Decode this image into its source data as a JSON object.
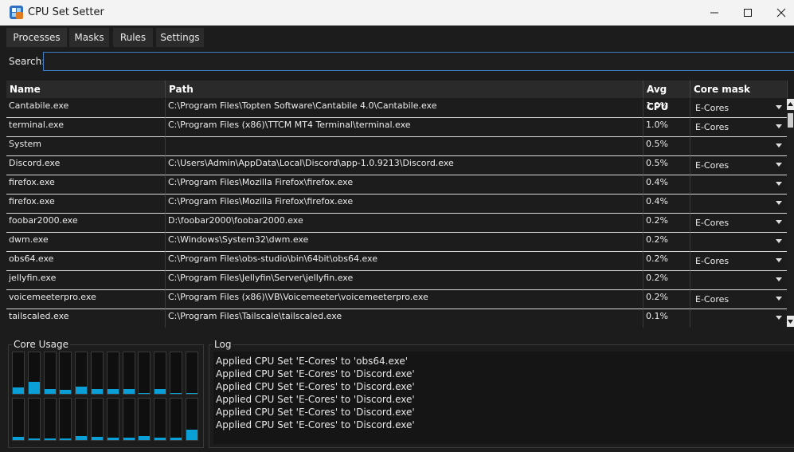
{
  "window": {
    "title": "CPU Set Setter",
    "controls": [
      "minimize-icon",
      "maximize-icon",
      "close-icon"
    ]
  },
  "tabs": [
    {
      "label": "Processes",
      "active": true
    },
    {
      "label": "Masks",
      "active": false
    },
    {
      "label": "Rules",
      "active": false
    },
    {
      "label": "Settings",
      "active": false
    }
  ],
  "search": {
    "label": "Search:",
    "value": ""
  },
  "table": {
    "columns": [
      "Name",
      "Path",
      "Avg CPU",
      "Core mask"
    ],
    "rows": [
      {
        "name": "Cantabile.exe",
        "path": "C:\\Program Files\\Topten Software\\Cantabile 4.0\\Cantabile.exe",
        "cpu": "1.0%",
        "mask": "E-Cores"
      },
      {
        "name": "terminal.exe",
        "path": "C:\\Program Files (x86)\\TTCM MT4 Terminal\\terminal.exe",
        "cpu": "1.0%",
        "mask": "E-Cores"
      },
      {
        "name": "System",
        "path": "",
        "cpu": "0.5%",
        "mask": ""
      },
      {
        "name": "Discord.exe",
        "path": "C:\\Users\\Admin\\AppData\\Local\\Discord\\app-1.0.9213\\Discord.exe",
        "cpu": "0.5%",
        "mask": "E-Cores"
      },
      {
        "name": "firefox.exe",
        "path": "C:\\Program Files\\Mozilla Firefox\\firefox.exe",
        "cpu": "0.4%",
        "mask": ""
      },
      {
        "name": "firefox.exe",
        "path": "C:\\Program Files\\Mozilla Firefox\\firefox.exe",
        "cpu": "0.4%",
        "mask": ""
      },
      {
        "name": "foobar2000.exe",
        "path": "D:\\foobar2000\\foobar2000.exe",
        "cpu": "0.2%",
        "mask": "E-Cores"
      },
      {
        "name": "dwm.exe",
        "path": "C:\\Windows\\System32\\dwm.exe",
        "cpu": "0.2%",
        "mask": ""
      },
      {
        "name": "obs64.exe",
        "path": "C:\\Program Files\\obs-studio\\bin\\64bit\\obs64.exe",
        "cpu": "0.2%",
        "mask": "E-Cores"
      },
      {
        "name": "jellyfin.exe",
        "path": "C:\\Program Files\\Jellyfin\\Server\\jellyfin.exe",
        "cpu": "0.2%",
        "mask": ""
      },
      {
        "name": "voicemeeterpro.exe",
        "path": "C:\\Program Files (x86)\\VB\\Voicemeeter\\voicemeeterpro.exe",
        "cpu": "0.2%",
        "mask": "E-Cores"
      },
      {
        "name": "tailscaled.exe",
        "path": "C:\\Program Files\\Tailscale\\tailscaled.exe",
        "cpu": "0.1%",
        "mask": ""
      }
    ]
  },
  "core_usage": {
    "label": "Core Usage",
    "accent": "#0a9fd6",
    "levels_percent": [
      [
        15,
        28,
        12,
        10,
        18,
        12,
        12,
        12,
        2,
        12,
        2,
        2
      ],
      [
        8,
        4,
        3,
        4,
        10,
        7,
        5,
        5,
        10,
        5,
        5,
        25
      ]
    ]
  },
  "log": {
    "label": "Log",
    "lines": [
      "Applied CPU Set 'E-Cores' to 'obs64.exe'",
      "Applied CPU Set 'E-Cores' to 'Discord.exe'",
      "Applied CPU Set 'E-Cores' to 'Discord.exe'",
      "Applied CPU Set 'E-Cores' to 'Discord.exe'",
      "Applied CPU Set 'E-Cores' to 'Discord.exe'",
      "Applied CPU Set 'E-Cores' to 'Discord.exe'"
    ]
  }
}
